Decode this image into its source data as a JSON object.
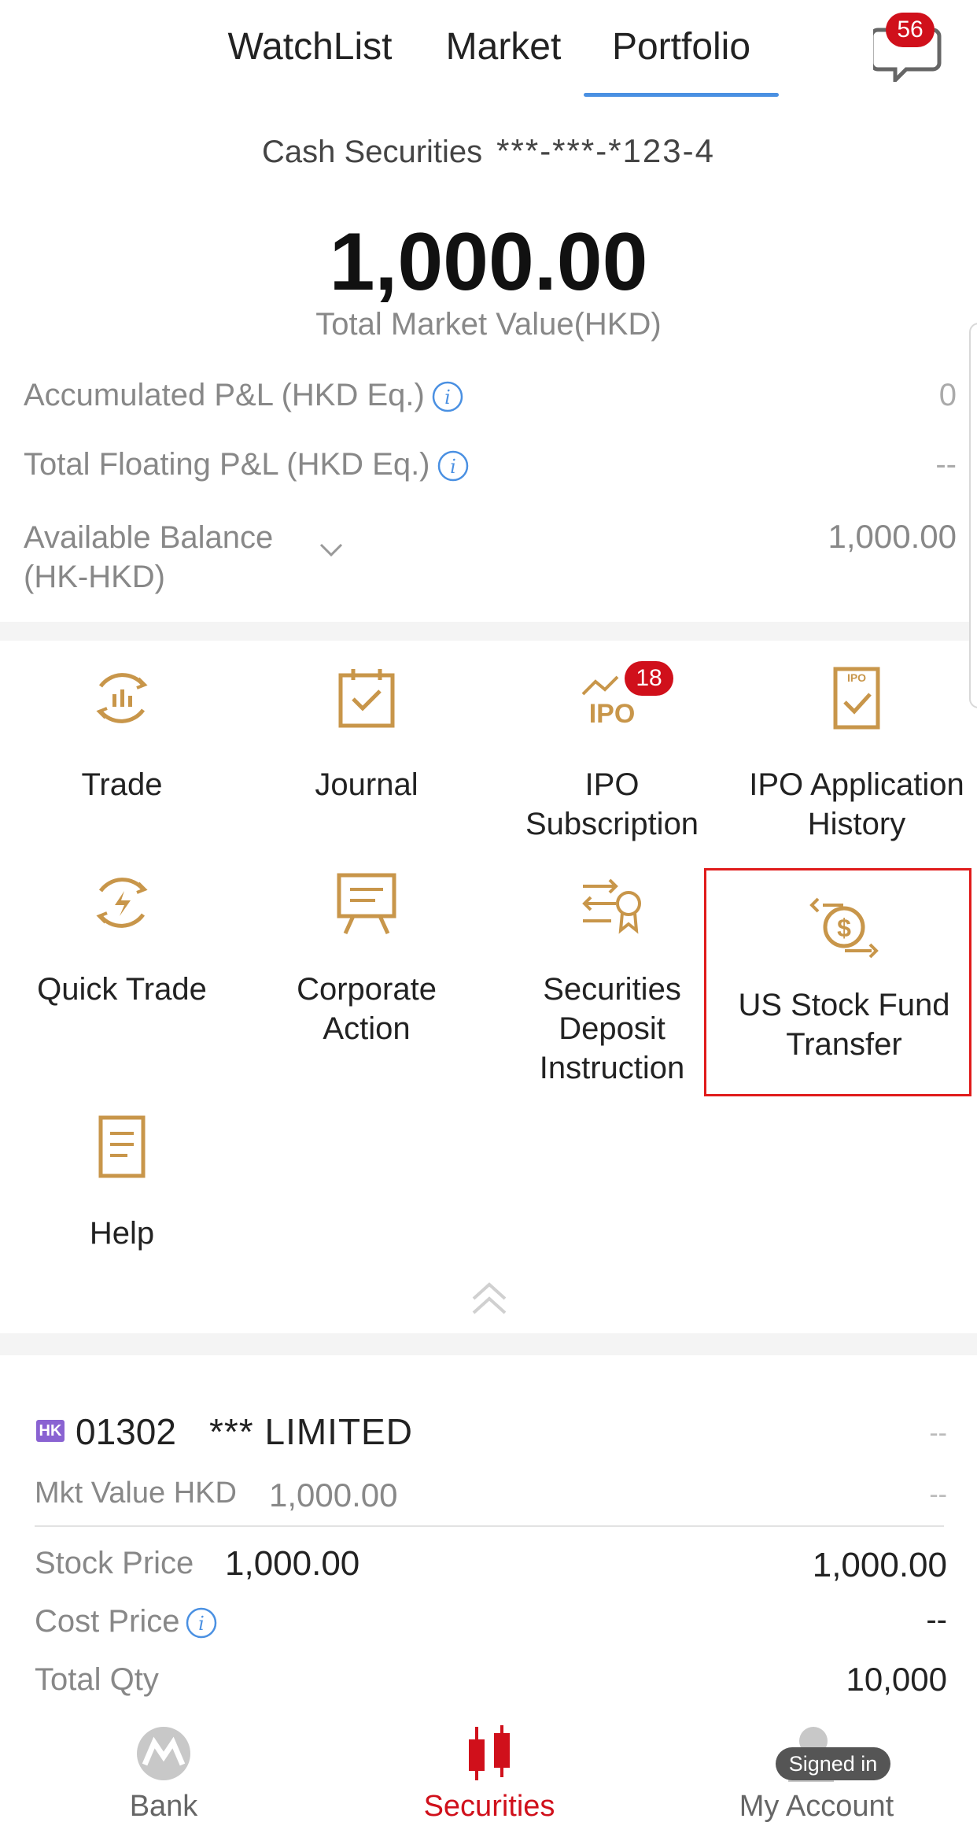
{
  "header": {
    "tabs": [
      {
        "label": "WatchList",
        "active": false
      },
      {
        "label": "Market",
        "active": false
      },
      {
        "label": "Portfolio",
        "active": true
      }
    ],
    "messages_badge": "56",
    "accent_color": "#4a90e2",
    "badge_color": "#d0101b"
  },
  "account": {
    "type_label": "Cash Securities",
    "number_masked": "***-***-*123-4",
    "total_value": "1,000.00",
    "total_value_label": "Total Market Value(HKD)",
    "accumulated_pl_label": "Accumulated P&L (HKD Eq.)",
    "accumulated_pl_value": "0",
    "floating_pl_label": "Total Floating P&L (HKD Eq.)",
    "floating_pl_value": "--",
    "available_balance_label": "Available Balance\n(HK-HKD)",
    "available_balance_value": "1,000.00"
  },
  "shortcuts": {
    "icon_color": "#c8964a",
    "items": [
      {
        "label": "Trade",
        "icon": "trade-icon"
      },
      {
        "label": "Journal",
        "icon": "journal-icon"
      },
      {
        "label": "IPO\nSubscription",
        "icon": "ipo-icon",
        "badge": "18"
      },
      {
        "label": "IPO Application\nHistory",
        "icon": "ipo-history-icon"
      },
      {
        "label": "Quick Trade",
        "icon": "quick-trade-icon"
      },
      {
        "label": "Corporate\nAction",
        "icon": "corporate-action-icon"
      },
      {
        "label": "Securities\nDeposit\nInstruction",
        "icon": "securities-deposit-icon"
      },
      {
        "label": "US Stock Fund\nTransfer",
        "icon": "fund-transfer-icon",
        "highlighted": true
      },
      {
        "label": "Help",
        "icon": "help-icon"
      }
    ]
  },
  "holding": {
    "market_tag": "HK",
    "code": "01302",
    "name": "*** LIMITED",
    "change_top": "--",
    "mkt_value_label": "Mkt Value HKD",
    "mkt_value": "1,000.00",
    "change_second": "--",
    "stock_price_label": "Stock Price",
    "stock_price": "1,000.00",
    "stock_price_right": "1,000.00",
    "cost_price_label": "Cost Price",
    "cost_price_right": "--",
    "total_qty_label": "Total Qty",
    "total_qty_right": "10,000"
  },
  "bottom_nav": {
    "items": [
      {
        "label": "Bank",
        "icon": "bank-logo-icon",
        "active": false
      },
      {
        "label": "Securities",
        "icon": "candlestick-icon",
        "active": true
      },
      {
        "label": "My Account",
        "icon": "user-icon",
        "active": false
      }
    ],
    "signed_in_label": "Signed in"
  }
}
